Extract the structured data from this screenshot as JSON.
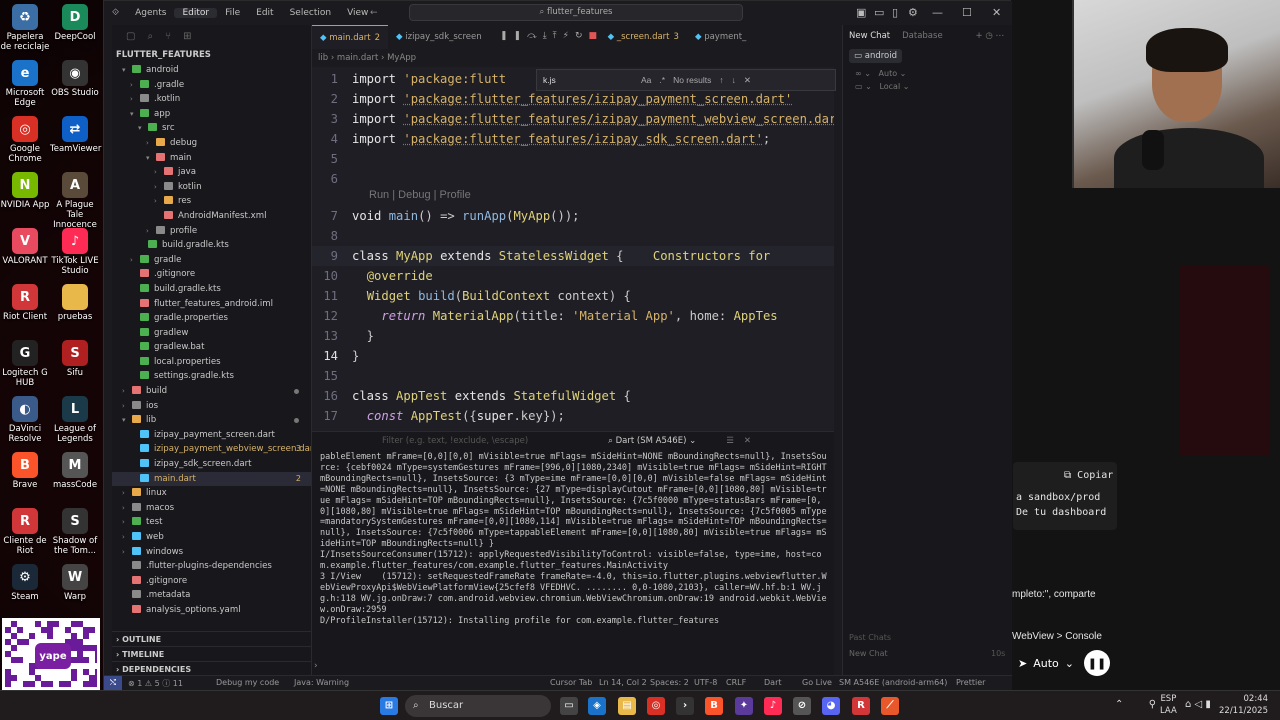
{
  "desktop_icons": [
    {
      "label": "Papelera de reciclaje",
      "icon": "recycle-bin-icon",
      "color": "#3a6ea5",
      "glyph": "♻"
    },
    {
      "label": "DeepCool",
      "icon": "deepcool-icon",
      "color": "#1b8a5a",
      "glyph": "D"
    },
    {
      "label": "Microsoft Edge",
      "icon": "edge-icon",
      "color": "#1a73c8",
      "glyph": "e"
    },
    {
      "label": "OBS Studio",
      "icon": "obs-icon",
      "color": "#333333",
      "glyph": "◉"
    },
    {
      "label": "Google Chrome",
      "icon": "chrome-icon",
      "color": "#d93025",
      "glyph": "◎"
    },
    {
      "label": "TeamViewer",
      "icon": "teamviewer-icon",
      "color": "#0e60c7",
      "glyph": "⇄"
    },
    {
      "label": "NVIDIA App",
      "icon": "nvidia-icon",
      "color": "#76b900",
      "glyph": "N"
    },
    {
      "label": "A Plague Tale Innocence",
      "icon": "game-icon",
      "color": "#5a4a3a",
      "glyph": "A"
    },
    {
      "label": "VALORANT",
      "icon": "valorant-icon",
      "color": "#e84a5f",
      "glyph": "V"
    },
    {
      "label": "TikTok LIVE Studio",
      "icon": "tiktok-icon",
      "color": "#fe2c55",
      "glyph": "♪"
    },
    {
      "label": "Riot Client",
      "icon": "riot-icon",
      "color": "#d13639",
      "glyph": "R"
    },
    {
      "label": "pruebas",
      "icon": "folder-icon",
      "color": "#e8b84a",
      "glyph": ""
    },
    {
      "label": "Logitech G HUB",
      "icon": "logitech-icon",
      "color": "#222222",
      "glyph": "G"
    },
    {
      "label": "Sifu",
      "icon": "sifu-icon",
      "color": "#b02020",
      "glyph": "S"
    },
    {
      "label": "DaVinci Resolve",
      "icon": "davinci-icon",
      "color": "#3a5a8a",
      "glyph": "◐"
    },
    {
      "label": "League of Legends",
      "icon": "lol-icon",
      "color": "#1a3a4a",
      "glyph": "L"
    },
    {
      "label": "Brave",
      "icon": "brave-icon",
      "color": "#fb542b",
      "glyph": "B"
    },
    {
      "label": "massCode",
      "icon": "masscode-icon",
      "color": "#555555",
      "glyph": "M"
    },
    {
      "label": "Cliente de Riot",
      "icon": "riot-client-icon",
      "color": "#d13639",
      "glyph": "R"
    },
    {
      "label": "Shadow of the Tom...",
      "icon": "shadow-icon",
      "color": "#333333",
      "glyph": "S"
    },
    {
      "label": "Steam",
      "icon": "steam-icon",
      "color": "#1b2838",
      "glyph": "⚙"
    },
    {
      "label": "Warp",
      "icon": "warp-icon",
      "color": "#444444",
      "glyph": "W"
    }
  ],
  "qr_logo": "yape",
  "titlebar": {
    "menus": [
      "Agents",
      "Editor",
      "File",
      "Edit",
      "Selection",
      "View"
    ],
    "active_menu": "Editor",
    "search": "flutter_features"
  },
  "sidebar": {
    "title": "FLUTTER_FEATURES",
    "items": [
      {
        "label": "android",
        "depth": 1,
        "chev": "▾",
        "color": "#4caf50"
      },
      {
        "label": ".gradle",
        "depth": 2,
        "chev": "›",
        "color": "#4caf50"
      },
      {
        "label": ".kotlin",
        "depth": 2,
        "chev": "›",
        "color": "#8a8a8a"
      },
      {
        "label": "app",
        "depth": 2,
        "chev": "▾",
        "color": "#4caf50"
      },
      {
        "label": "src",
        "depth": 3,
        "chev": "▾",
        "color": "#4caf50"
      },
      {
        "label": "debug",
        "depth": 4,
        "chev": "›",
        "color": "#e8a94a"
      },
      {
        "label": "main",
        "depth": 4,
        "chev": "▾",
        "color": "#e57373"
      },
      {
        "label": "java",
        "depth": 5,
        "chev": "›",
        "color": "#e57373"
      },
      {
        "label": "kotlin",
        "depth": 5,
        "chev": "›",
        "color": "#8a8a8a"
      },
      {
        "label": "res",
        "depth": 5,
        "chev": "›",
        "color": "#e8a94a"
      },
      {
        "label": "AndroidManifest.xml",
        "depth": 5,
        "chev": "",
        "color": "#e57373"
      },
      {
        "label": "profile",
        "depth": 4,
        "chev": "›",
        "color": "#8a8a8a"
      },
      {
        "label": "build.gradle.kts",
        "depth": 3,
        "chev": "",
        "color": "#4caf50"
      },
      {
        "label": "gradle",
        "depth": 2,
        "chev": "›",
        "color": "#4caf50"
      },
      {
        "label": ".gitignore",
        "depth": 2,
        "chev": "",
        "color": "#e57373"
      },
      {
        "label": "build.gradle.kts",
        "depth": 2,
        "chev": "",
        "color": "#4caf50"
      },
      {
        "label": "flutter_features_android.iml",
        "depth": 2,
        "chev": "",
        "color": "#e57373"
      },
      {
        "label": "gradle.properties",
        "depth": 2,
        "chev": "",
        "color": "#4caf50"
      },
      {
        "label": "gradlew",
        "depth": 2,
        "chev": "",
        "color": "#4caf50"
      },
      {
        "label": "gradlew.bat",
        "depth": 2,
        "chev": "",
        "color": "#4caf50"
      },
      {
        "label": "local.properties",
        "depth": 2,
        "chev": "",
        "color": "#4caf50"
      },
      {
        "label": "settings.gradle.kts",
        "depth": 2,
        "chev": "",
        "color": "#4caf50"
      },
      {
        "label": "build",
        "depth": 1,
        "chev": "›",
        "color": "#e57373",
        "dot": true
      },
      {
        "label": "ios",
        "depth": 1,
        "chev": "›",
        "color": "#8a8a8a"
      },
      {
        "label": "lib",
        "depth": 1,
        "chev": "▾",
        "color": "#e8a94a",
        "dot": true
      },
      {
        "label": "izipay_payment_screen.dart",
        "depth": 2,
        "chev": "",
        "color": "#4fc3f7"
      },
      {
        "label": "izipay_payment_webview_screen.dart",
        "depth": 2,
        "chev": "",
        "color": "#4fc3f7",
        "badge": "3",
        "warn": true
      },
      {
        "label": "izipay_sdk_screen.dart",
        "depth": 2,
        "chev": "",
        "color": "#4fc3f7"
      },
      {
        "label": "main.dart",
        "depth": 2,
        "chev": "",
        "color": "#4fc3f7",
        "badge": "2",
        "selected": true,
        "warn": true
      },
      {
        "label": "linux",
        "depth": 1,
        "chev": "›",
        "color": "#e8a94a"
      },
      {
        "label": "macos",
        "depth": 1,
        "chev": "›",
        "color": "#8a8a8a"
      },
      {
        "label": "test",
        "depth": 1,
        "chev": "›",
        "color": "#4caf50"
      },
      {
        "label": "web",
        "depth": 1,
        "chev": "›",
        "color": "#4fc3f7"
      },
      {
        "label": "windows",
        "depth": 1,
        "chev": "›",
        "color": "#4fc3f7"
      },
      {
        "label": ".flutter-plugins-dependencies",
        "depth": 1,
        "chev": "",
        "color": "#8a8a8a"
      },
      {
        "label": ".gitignore",
        "depth": 1,
        "chev": "",
        "color": "#e57373"
      },
      {
        "label": ".metadata",
        "depth": 1,
        "chev": "",
        "color": "#8a8a8a"
      },
      {
        "label": "analysis_options.yaml",
        "depth": 1,
        "chev": "",
        "color": "#e57373"
      }
    ],
    "footers": [
      "OUTLINE",
      "TIMELINE",
      "DEPENDENCIES"
    ]
  },
  "tabs": [
    {
      "label": "main.dart",
      "num": "2",
      "active": true
    },
    {
      "label": "izipay_sdk_screen",
      "num": ""
    },
    {
      "label": "_screen.dart",
      "num": "3"
    },
    {
      "label": "payment_",
      "num": ""
    }
  ],
  "breadcrumb": "lib  ›  main.dart  ›  MyApp",
  "find": {
    "query": "k.js",
    "result": "No results"
  },
  "code_lines": [
    {
      "n": "1",
      "html": "<span class='kw'>import</span> <span class='str2'>'package:flutt</span>"
    },
    {
      "n": "2",
      "html": "<span class='kw'>import</span> <span class='str'>'package:flutter_features/izipay_payment_screen.dart'</span>"
    },
    {
      "n": "3",
      "html": "<span class='kw'>import</span> <span class='str'>'package:flutter_features/izipay_payment_webview_screen.dart'</span>"
    },
    {
      "n": "4",
      "html": "<span class='kw'>import</span> <span class='str'>'package:flutter_features/izipay_sdk_screen.dart'</span>;"
    },
    {
      "n": "5",
      "html": ""
    },
    {
      "n": "6",
      "html": ""
    },
    {
      "n": "7",
      "html": "<span class='kw'>void</span> <span class='fn'>main</span>() => <span class='fn'>runApp</span>(<span class='cls'>MyApp</span>());"
    },
    {
      "n": "8",
      "html": ""
    },
    {
      "n": "9",
      "html": "<span class='kw'>class</span> <span class='cls'>MyApp</span> <span class='kw'>extends</span> <span class='cls'>StatelessWidget</span> {    <span class='cls'>Constructors for</span>"
    },
    {
      "n": "10",
      "html": "  <span class='cls'>@override</span>"
    },
    {
      "n": "11",
      "html": "  <span class='cls'>Widget</span> <span class='fn'>build</span>(<span class='cls'>BuildContext</span> context) {"
    },
    {
      "n": "12",
      "html": "    <span class='kw2'>return</span> <span class='cls'>MaterialApp</span>(title: <span class='str2'>'Material App'</span>, home: <span class='cls'>AppTes</span>"
    },
    {
      "n": "13",
      "html": "  }"
    },
    {
      "n": "14",
      "html": "}"
    },
    {
      "n": "15",
      "html": ""
    },
    {
      "n": "16",
      "html": "<span class='kw'>class</span> <span class='cls'>AppTest</span> <span class='kw'>extends</span> <span class='cls'>StatefulWidget</span> {"
    },
    {
      "n": "17",
      "html": "  <span class='kw2'>const</span> <span class='cls'>AppTest</span>({<span class='kw'>super</span>.key});"
    }
  ],
  "code_lens": "Run | Debug | Profile",
  "panel": {
    "filter_placeholder": "Filter (e.g. text, !exclude, \\escape)",
    "device": "Dart (SM A546E)",
    "console": "pableElement mFrame=[0,0][0,0] mVisible=true mFlags= mSideHint=NONE mBoundingRects=null}, InsetsSource: {cebf0024 mType=systemGestures mFrame=[996,0][1080,2340] mVisible=true mFlags= mSideHint=RIGHT mBoundingRects=null}, InsetsSource: {3 mType=ime mFrame=[0,0][0,0] mVisible=false mFlags= mSideHint=NONE mBoundingRects=null}, InsetsSource: {27 mType=displayCutout mFrame=[0,0][1080,80] mVisible=true mFlags= mSideHint=TOP mBoundingRects=null}, InsetsSource: {7c5f0000 mType=statusBars mFrame=[0,0][1080,80] mVisible=true mFlags= mSideHint=TOP mBoundingRects=null}, InsetsSource: {7c5f0005 mType=mandatorySystemGestures mFrame=[0,0][1080,114] mVisible=true mFlags= mSideHint=TOP mBoundingRects=null}, InsetsSource: {7c5f0006 mType=tappableElement mFrame=[0,0][1080,80] mVisible=true mFlags= mSideHint=TOP mBoundingRects=null} }\nI/InsetsSourceConsumer(15712): applyRequestedVisibilityToControl: visible=false, type=ime, host=com.example.flutter_features/com.example.flutter_features.MainActivity\n3 I/View    (15712): setRequestedFrameRate frameRate=-4.0, this=io.flutter.plugins.webviewflutter.WebViewProxyApi$WebViewPlatformView{25cfef8 VFEDHVC. ........ 0,0-1080,2103}, caller=WV.hf.b:1 WV.jg.h:118 WV.jg.onDraw:7 com.android.webview.chromium.WebViewChromium.onDraw:19 android.webkit.WebView.onDraw:2959\nD/ProfileInstaller(15712): Installing profile for com.example.flutter_features"
  },
  "chat": {
    "tab_new": "New Chat",
    "tab_db": "Database",
    "chip": "android",
    "model": "Auto",
    "local": "Local",
    "past": "Past Chats",
    "new_chat": "New Chat",
    "count": "10s"
  },
  "statusbar": {
    "problems": "⊗ 1 ⚠ 5 ⓘ 11",
    "debug": "Debug my code",
    "java": "Java: Warning",
    "cursor_tab": "Cursor Tab",
    "pos": "Ln 14, Col 2",
    "spaces": "Spaces: 2",
    "enc": "UTF-8",
    "eol": "CRLF",
    "lang": "Dart",
    "golive": "Go Live",
    "device": "SM A546E (android-arm64)",
    "prettier": "Prettier"
  },
  "bgapp": {
    "copy": "Copiar",
    "line1": "a sandbox/prod",
    "line2": "De tu dashboard",
    "line3": "mpleto:\", comparte",
    "line4": "WebView > Console",
    "auto": "Auto"
  },
  "taskbar": {
    "search": "Buscar",
    "lang1": "ESP",
    "lang2": "LAA",
    "time": "02:44",
    "date": "22/11/2025"
  }
}
